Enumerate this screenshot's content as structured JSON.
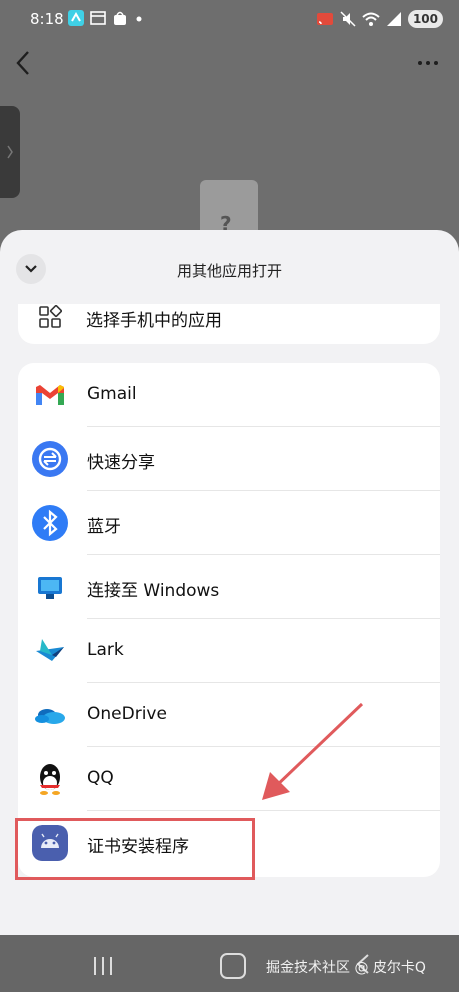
{
  "status_bar": {
    "time": "8:18",
    "battery": "100",
    "icons": [
      "mirror-app-icon",
      "calendar-icon",
      "bag-icon",
      "dot-icon",
      "cast-icon",
      "mute-icon",
      "wifi-icon",
      "signal-icon"
    ]
  },
  "sheet": {
    "title": "用其他应用打开",
    "choose_app_label": "选择手机中的应用"
  },
  "apps": [
    {
      "name": "Gmail",
      "icon": "gmail-icon",
      "color": "#ea4335"
    },
    {
      "name": "快速分享",
      "icon": "quick-share-icon",
      "color": "#3a78f2"
    },
    {
      "name": "蓝牙",
      "icon": "bluetooth-icon",
      "color": "#2f7cf6"
    },
    {
      "name": "连接至 Windows",
      "icon": "link-to-windows-icon",
      "color": "#1877d2"
    },
    {
      "name": "Lark",
      "icon": "lark-icon",
      "color": "#1a8ad3"
    },
    {
      "name": "OneDrive",
      "icon": "onedrive-icon",
      "color": "#0f6cbd"
    },
    {
      "name": "QQ",
      "icon": "qq-icon",
      "color": "#111111"
    },
    {
      "name": "证书安装程序",
      "icon": "certificate-installer-icon",
      "color": "#4a5fae"
    }
  ],
  "file_placeholder": "?",
  "watermark": "掘金技术社区 @ 皮尔卡Q",
  "colors": {
    "highlight": "#e05a5c",
    "sheet_bg": "#f2f2f4"
  }
}
